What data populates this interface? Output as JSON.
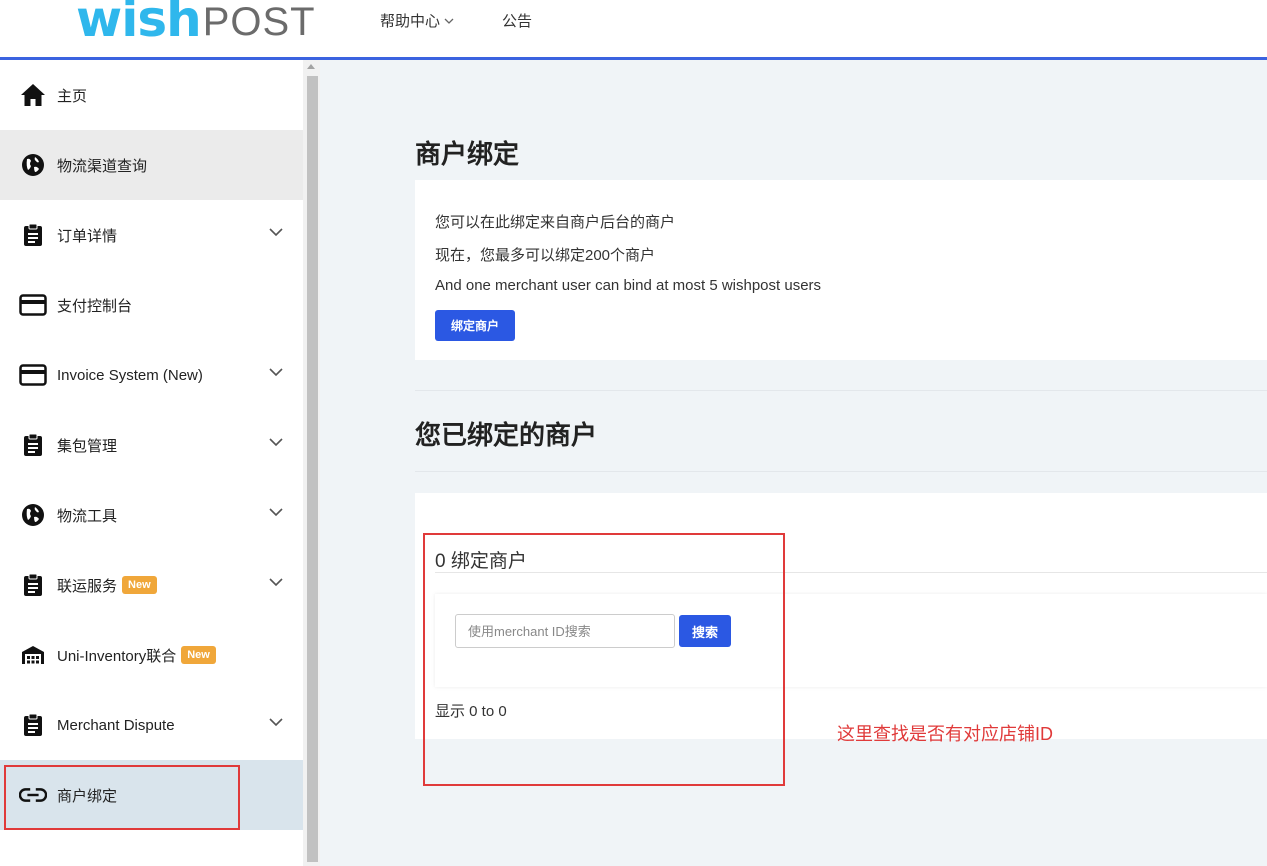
{
  "header": {
    "logo_wish": "wish",
    "logo_post": "POST",
    "nav": [
      {
        "label": "帮助中心",
        "has_dropdown": true
      },
      {
        "label": "公告",
        "has_dropdown": false
      }
    ],
    "accent_color": "#3b63e0"
  },
  "sidebar": {
    "items": [
      {
        "label": "主页",
        "icon": "home-icon"
      },
      {
        "label": "物流渠道查询",
        "icon": "globe-icon"
      },
      {
        "label": "订单详情",
        "icon": "clipboard-icon"
      },
      {
        "label": "支付控制台",
        "icon": "credit-card-icon"
      },
      {
        "label": "Invoice System (New)",
        "icon": "credit-card-icon"
      },
      {
        "label": "集包管理",
        "icon": "clipboard-icon"
      },
      {
        "label": "物流工具",
        "icon": "globe-icon"
      },
      {
        "label": "联运服务",
        "icon": "clipboard-icon",
        "badge": "New"
      },
      {
        "label": "Uni-Inventory联合",
        "icon": "warehouse-icon",
        "badge": "New"
      },
      {
        "label": "Merchant Dispute",
        "icon": "clipboard-icon"
      },
      {
        "label": "商户绑定",
        "icon": "link-icon"
      }
    ],
    "active_item": "商户绑定"
  },
  "main": {
    "page_title": "商户绑定",
    "intro": {
      "line1": "您可以在此绑定来自商户后台的商户",
      "line2": "现在，您最多可以绑定200个商户",
      "line3": "And one merchant user can bind at most 5 wishpost users",
      "bind_button": "绑定商户"
    },
    "bound_section": {
      "title": "您已绑定的商户",
      "count_label": "0 绑定商户",
      "search_placeholder": "使用merchant ID搜索",
      "search_button": "搜索",
      "range_text": "显示 0 to 0"
    },
    "annotation": "这里查找是否有对应店铺ID",
    "annotation_color": "#e03a3a"
  }
}
